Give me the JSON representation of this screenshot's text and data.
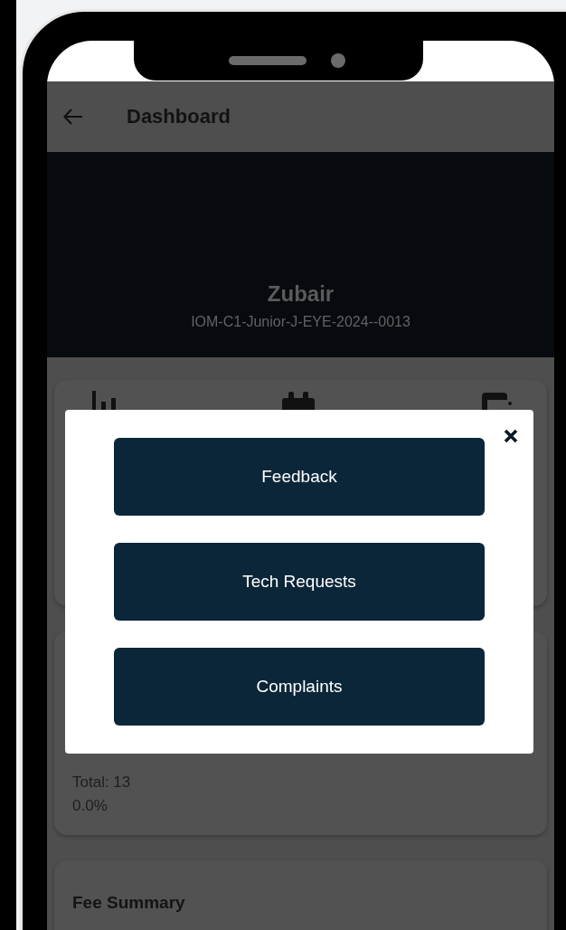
{
  "app_bar": {
    "title": "Dashboard"
  },
  "profile": {
    "name": "Zubair",
    "id": "IOM-C1-Junior-J-EYE-2024--0013"
  },
  "attendance_card": {
    "total": "Total: 13",
    "percent": "0.0%"
  },
  "fee_card": {
    "title": "Fee Summary"
  },
  "dialog": {
    "buttons": [
      "Feedback",
      "Tech Requests",
      "Complaints"
    ]
  }
}
